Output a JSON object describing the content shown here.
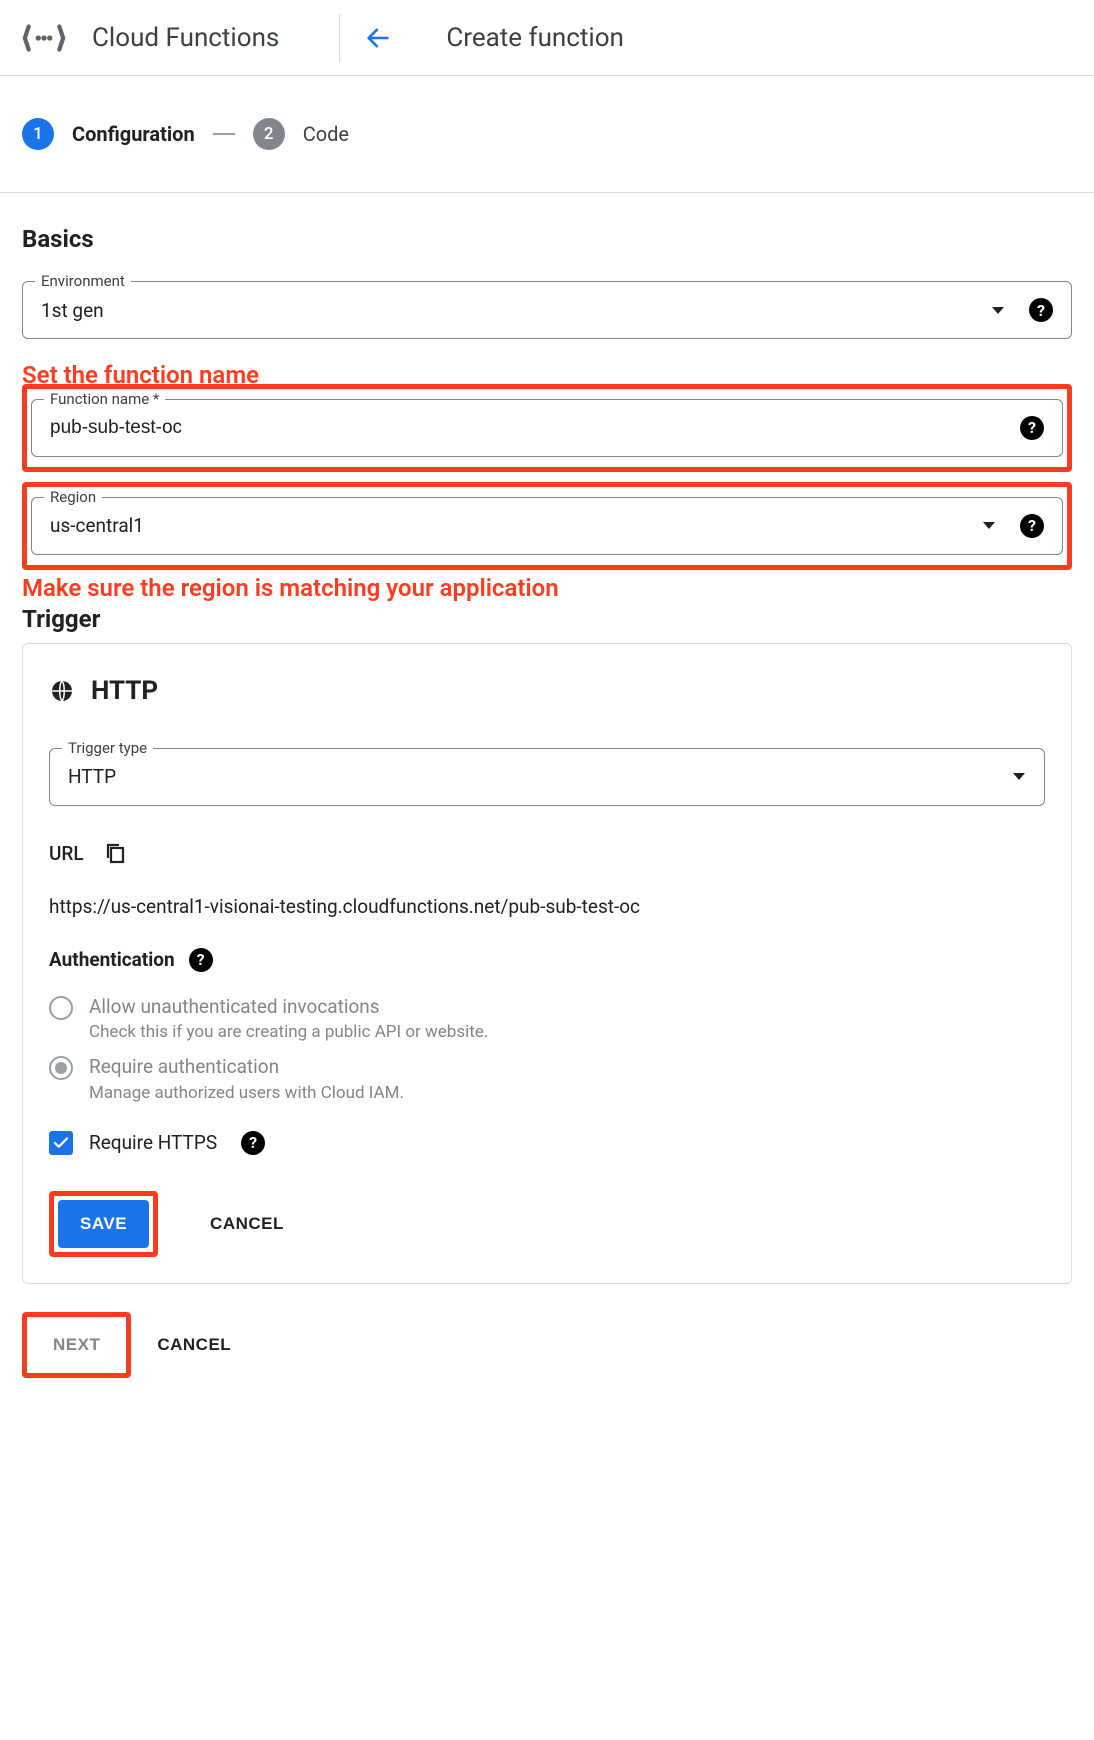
{
  "header": {
    "product_title": "Cloud Functions",
    "page_title": "Create function"
  },
  "stepper": {
    "step1_num": "1",
    "step1_label": "Configuration",
    "step2_num": "2",
    "step2_label": "Code"
  },
  "basics": {
    "title": "Basics",
    "environment_label": "Environment",
    "environment_value": "1st gen",
    "function_name_label": "Function name *",
    "function_name_value": "pub-sub-test-oc",
    "region_label": "Region",
    "region_value": "us-central1"
  },
  "annotations": {
    "set_function_name": "Set the function name",
    "region_match": "Make sure the region is matching your application"
  },
  "trigger": {
    "section_title": "Trigger",
    "heading": "HTTP",
    "trigger_type_label": "Trigger type",
    "trigger_type_value": "HTTP",
    "url_label": "URL",
    "url_value": "https://us-central1-visionai-testing.cloudfunctions.net/pub-sub-test-oc",
    "auth_label": "Authentication",
    "radio_unauth_title": "Allow unauthenticated invocations",
    "radio_unauth_sub": "Check this if you are creating a public API or website.",
    "radio_auth_title": "Require authentication",
    "radio_auth_sub": "Manage authorized users with Cloud IAM.",
    "require_https_label": "Require HTTPS",
    "save_label": "SAVE",
    "cancel_label": "CANCEL"
  },
  "footer": {
    "next_label": "NEXT",
    "cancel_label": "CANCEL"
  }
}
